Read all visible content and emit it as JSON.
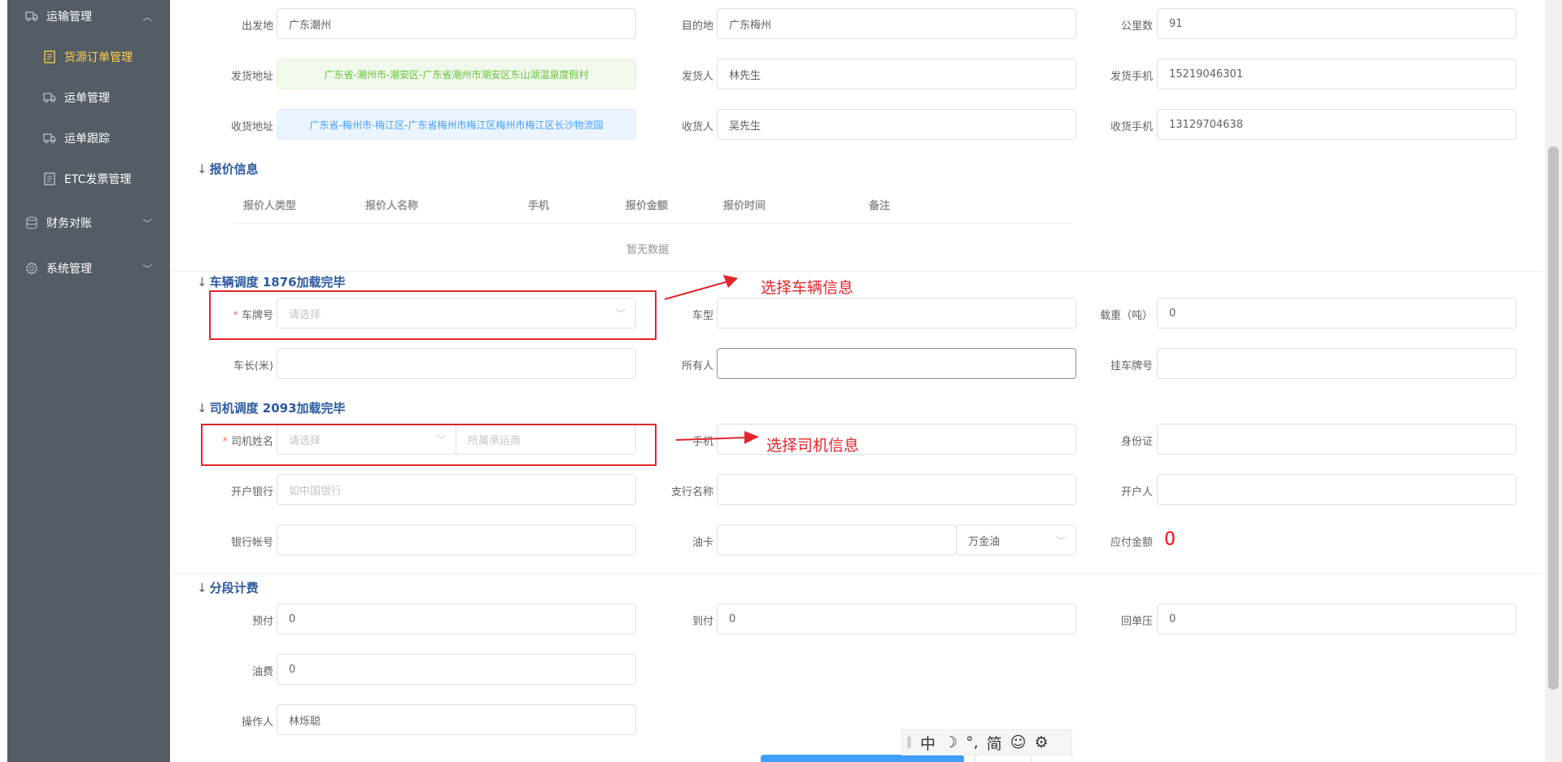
{
  "sidebar": {
    "items": [
      {
        "label": "运输管理",
        "icon": "truck-icon"
      },
      {
        "label": "货源订单管理",
        "icon": "document-icon"
      },
      {
        "label": "运单管理",
        "icon": "truck-icon"
      },
      {
        "label": "运单跟踪",
        "icon": "truck-icon"
      },
      {
        "label": "ETC发票管理",
        "icon": "document-icon"
      },
      {
        "label": "财务对账",
        "icon": "database-icon"
      },
      {
        "label": "系统管理",
        "icon": "gear-icon"
      }
    ]
  },
  "route": {
    "origin_label": "出发地",
    "origin_value": "广东潮州",
    "dest_label": "目的地",
    "dest_value": "广东梅州",
    "km_label": "公里数",
    "km_value": "91"
  },
  "shipper": {
    "addr_label": "发货地址",
    "addr_value": "广东省-潮州市-潮安区-广东省潮州市潮安区东山湖温泉度假村",
    "name_label": "发货人",
    "name_value": "林先生",
    "phone_label": "发货手机",
    "phone_value": "15219046301"
  },
  "receiver": {
    "addr_label": "收货地址",
    "addr_value": "广东省-梅州市-梅江区-广东省梅州市梅江区梅州市梅江区长沙物流园",
    "name_label": "收货人",
    "name_value": "吴先生",
    "phone_label": "收货手机",
    "phone_value": "13129704638"
  },
  "quote": {
    "title": "报价信息",
    "columns": [
      "报价人类型",
      "报价人名称",
      "手机",
      "报价金额",
      "报价时间",
      "备注"
    ],
    "empty": "暂无数据"
  },
  "vehicle": {
    "title": "车辆调度 1876加载完毕",
    "plate_label": "车牌号",
    "plate_placeholder": "请选择",
    "type_label": "车型",
    "type_value": "",
    "load_label": "载重（吨）",
    "load_value": "0",
    "length_label": "车长(米)",
    "length_value": "",
    "owner_label": "所有人",
    "owner_value": "",
    "trailer_label": "挂车牌号",
    "trailer_value": ""
  },
  "driver": {
    "title": "司机调度 2093加载完毕",
    "name_label": "司机姓名",
    "name_placeholder": "请选择",
    "carrier_placeholder": "所属承运商",
    "phone_label": "手机",
    "id_label": "身份证",
    "id_value": "",
    "bank_label": "开户银行",
    "bank_placeholder": "如中国银行",
    "branch_label": "支行名称",
    "branch_value": "",
    "holder_label": "开户人",
    "holder_value": "",
    "account_label": "银行帐号",
    "account_value": "",
    "oilcard_label": "油卡",
    "oilcard_value": "",
    "oil_brand": "万金油",
    "due_label": "应付金额",
    "due_value": "0"
  },
  "billing": {
    "title": "分段计费",
    "prepay_label": "预付",
    "prepay_value": "0",
    "cod_label": "到付",
    "cod_value": "0",
    "receipt_label": "回单压",
    "receipt_value": "0",
    "fuel_label": "油费",
    "fuel_value": "0",
    "operator_label": "操作人",
    "operator_value": "林烁聪"
  },
  "annotations": {
    "vehicle_note": "选择车辆信息",
    "driver_note": "选择司机信息"
  },
  "ime": {
    "items": [
      "中",
      "☽",
      "°,",
      "简",
      "☺",
      "⚙"
    ]
  },
  "colors": {
    "sidebar_bg": "#545c64",
    "active": "#ffd04b",
    "annotation_red": "#e3262b",
    "section_title": "#2c5aa0"
  }
}
